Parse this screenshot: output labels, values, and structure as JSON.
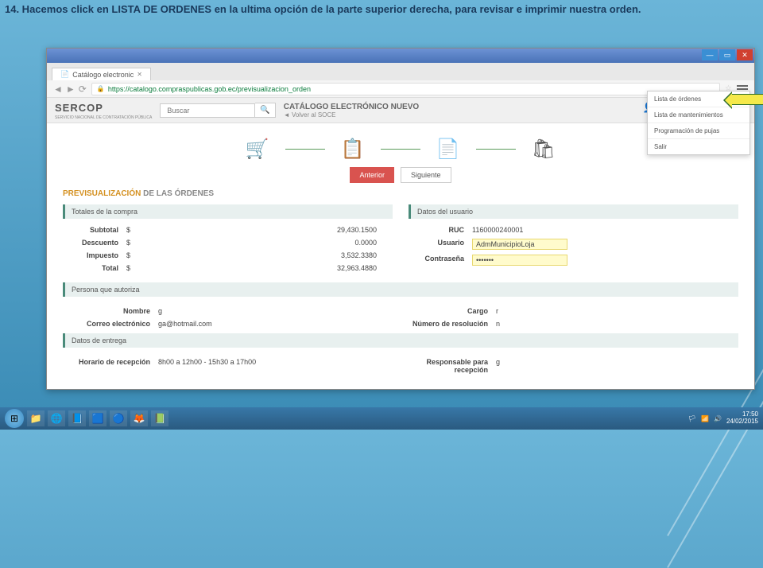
{
  "instruction": "14. Hacemos click en LISTA DE ORDENES en la ultima opción de la parte superior derecha, para revisar e imprimir nuestra orden.",
  "browser": {
    "tab_title": "Catálogo electronic",
    "url": "https://catalogo.compraspublicas.gob.ec/previsualizacion_orden",
    "status_url": "catalogo.compraspublicas.gob.ec/ordenes"
  },
  "header": {
    "logo": "SERCOP",
    "logo_sub": "SERVICIO NACIONAL DE CONTRATACIÓN PÚBLICA",
    "search_placeholder": "Buscar",
    "title": "CATÁLOGO ELECTRÓNICO NUEVO",
    "back_link": "Volver al SOCE"
  },
  "dropdown": {
    "items": [
      "Lista de órdenes",
      "Lista de mantenimientos",
      "Programación de pujas",
      "Salir"
    ]
  },
  "nav": {
    "btn_prev": "Anterior",
    "btn_next": "Siguiente"
  },
  "page_title_pre": "PREVISUALIZACIÓN",
  "page_title_post": " DE LAS ÓRDENES",
  "sections": {
    "totales": {
      "title": "Totales de la compra",
      "rows": [
        {
          "label": "Subtotal",
          "sym": "$",
          "val": "29,430.1500"
        },
        {
          "label": "Descuento",
          "sym": "$",
          "val": "0.0000"
        },
        {
          "label": "Impuesto",
          "sym": "$",
          "val": "3,532.3380"
        },
        {
          "label": "Total",
          "sym": "$",
          "val": "32,963.4880"
        }
      ]
    },
    "usuario": {
      "title": "Datos del usuario",
      "rows": [
        {
          "label": "RUC",
          "val": "1160000240001"
        },
        {
          "label": "Usuario",
          "val": "AdmMunicipioLoja"
        },
        {
          "label": "Contraseña",
          "val": "•••••••"
        }
      ]
    },
    "persona": {
      "title": "Persona que autoriza",
      "rows": [
        {
          "label": "Nombre",
          "val": "g"
        },
        {
          "label": "Cargo",
          "val": "r"
        },
        {
          "label": "Correo electrónico",
          "val": "ga@hotmail.com"
        },
        {
          "label": "Número de resolución",
          "val": "n"
        }
      ]
    },
    "entrega": {
      "title": "Datos de entrega",
      "rows": [
        {
          "label": "Horario de recepción",
          "val": "8h00 a 12h00 - 15h30 a 17h00"
        },
        {
          "label": "Responsable para recepción",
          "val": "g"
        }
      ]
    }
  },
  "clock": {
    "time": "17:50",
    "date": "24/02/2015"
  }
}
